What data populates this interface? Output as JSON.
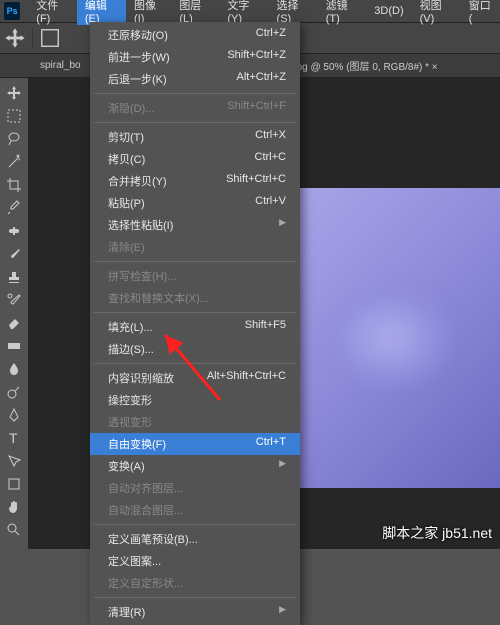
{
  "app": {
    "logo": "Ps"
  },
  "menubar": {
    "items": [
      {
        "label": "文件(F)"
      },
      {
        "label": "编辑(E)"
      },
      {
        "label": "图像(I)"
      },
      {
        "label": "图层(L)"
      },
      {
        "label": "文字(Y)"
      },
      {
        "label": "选择(S)"
      },
      {
        "label": "滤镜(T)"
      },
      {
        "label": "3D(D)"
      },
      {
        "label": "视图(V)"
      },
      {
        "label": "窗口("
      }
    ]
  },
  "tabbar": {
    "tab0": "spiral_bo",
    "tab1": "og @ 50% (图层 0, RGB/8#) * ×"
  },
  "menu": {
    "items": [
      {
        "label": "还原移动(O)",
        "shortcut": "Ctrl+Z"
      },
      {
        "label": "前进一步(W)",
        "shortcut": "Shift+Ctrl+Z"
      },
      {
        "label": "后退一步(K)",
        "shortcut": "Alt+Ctrl+Z"
      },
      {
        "sep": true
      },
      {
        "label": "渐隐(D)...",
        "shortcut": "Shift+Ctrl+F",
        "disabled": true
      },
      {
        "sep": true
      },
      {
        "label": "剪切(T)",
        "shortcut": "Ctrl+X"
      },
      {
        "label": "拷贝(C)",
        "shortcut": "Ctrl+C"
      },
      {
        "label": "合并拷贝(Y)",
        "shortcut": "Shift+Ctrl+C"
      },
      {
        "label": "粘贴(P)",
        "shortcut": "Ctrl+V"
      },
      {
        "label": "选择性粘贴(I)",
        "submenu": true
      },
      {
        "label": "清除(E)",
        "disabled": true
      },
      {
        "sep": true
      },
      {
        "label": "拼写检查(H)...",
        "disabled": true
      },
      {
        "label": "查找和替换文本(X)...",
        "disabled": true
      },
      {
        "sep": true
      },
      {
        "label": "填充(L)...",
        "shortcut": "Shift+F5"
      },
      {
        "label": "描边(S)..."
      },
      {
        "sep": true
      },
      {
        "label": "内容识别缩放",
        "shortcut": "Alt+Shift+Ctrl+C"
      },
      {
        "label": "操控变形"
      },
      {
        "label": "透视变形",
        "disabled": true
      },
      {
        "label": "自由变换(F)",
        "shortcut": "Ctrl+T",
        "highlight": true
      },
      {
        "label": "变换(A)",
        "submenu": true
      },
      {
        "label": "自动对齐图层...",
        "disabled": true
      },
      {
        "label": "自动混合图层...",
        "disabled": true
      },
      {
        "sep": true
      },
      {
        "label": "定义画笔预设(B)..."
      },
      {
        "label": "定义图案..."
      },
      {
        "label": "定义自定形状...",
        "disabled": true
      },
      {
        "sep": true
      },
      {
        "label": "清理(R)",
        "submenu": true
      }
    ]
  },
  "watermark": "脚本之家 jb51.net"
}
